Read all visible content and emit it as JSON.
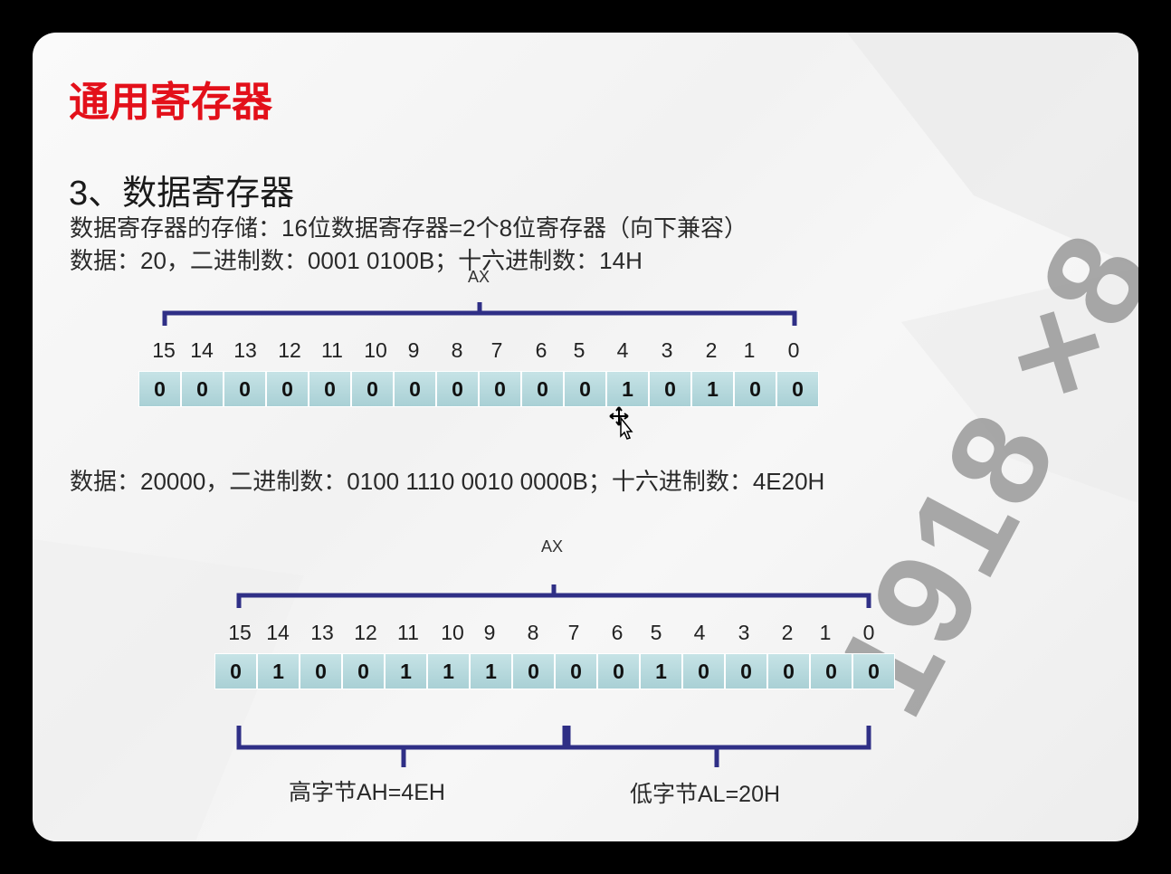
{
  "title": "通用寄存器",
  "subtitle": "3、数据寄存器",
  "line1": "数据寄存器的存储：16位数据寄存器=2个8位寄存器（向下兼容）",
  "line2": "数据：20，二进制数：0001 0100B；十六进制数：14H",
  "line3": "数据：20000，二进制数：0100 1110 0010 0000B；十六进制数：4E20H",
  "watermark": "1918 ×8",
  "register1": {
    "label": "AX",
    "bit_numbers": [
      "15",
      "14",
      "13",
      "12",
      "11",
      "10",
      "9",
      "8",
      "7",
      "6",
      "5",
      "4",
      "3",
      "2",
      "1",
      "0"
    ],
    "bits": [
      "0",
      "0",
      "0",
      "0",
      "0",
      "0",
      "0",
      "0",
      "0",
      "0",
      "0",
      "1",
      "0",
      "1",
      "0",
      "0"
    ]
  },
  "register2": {
    "label": "AX",
    "bit_numbers": [
      "15",
      "14",
      "13",
      "12",
      "11",
      "10",
      "9",
      "8",
      "7",
      "6",
      "5",
      "4",
      "3",
      "2",
      "1",
      "0"
    ],
    "bits": [
      "0",
      "1",
      "0",
      "0",
      "1",
      "1",
      "1",
      "0",
      "0",
      "0",
      "1",
      "0",
      "0",
      "0",
      "0",
      "0"
    ],
    "high_byte_label": "高字节AH=4EH",
    "low_byte_label": "低字节AL=20H"
  }
}
